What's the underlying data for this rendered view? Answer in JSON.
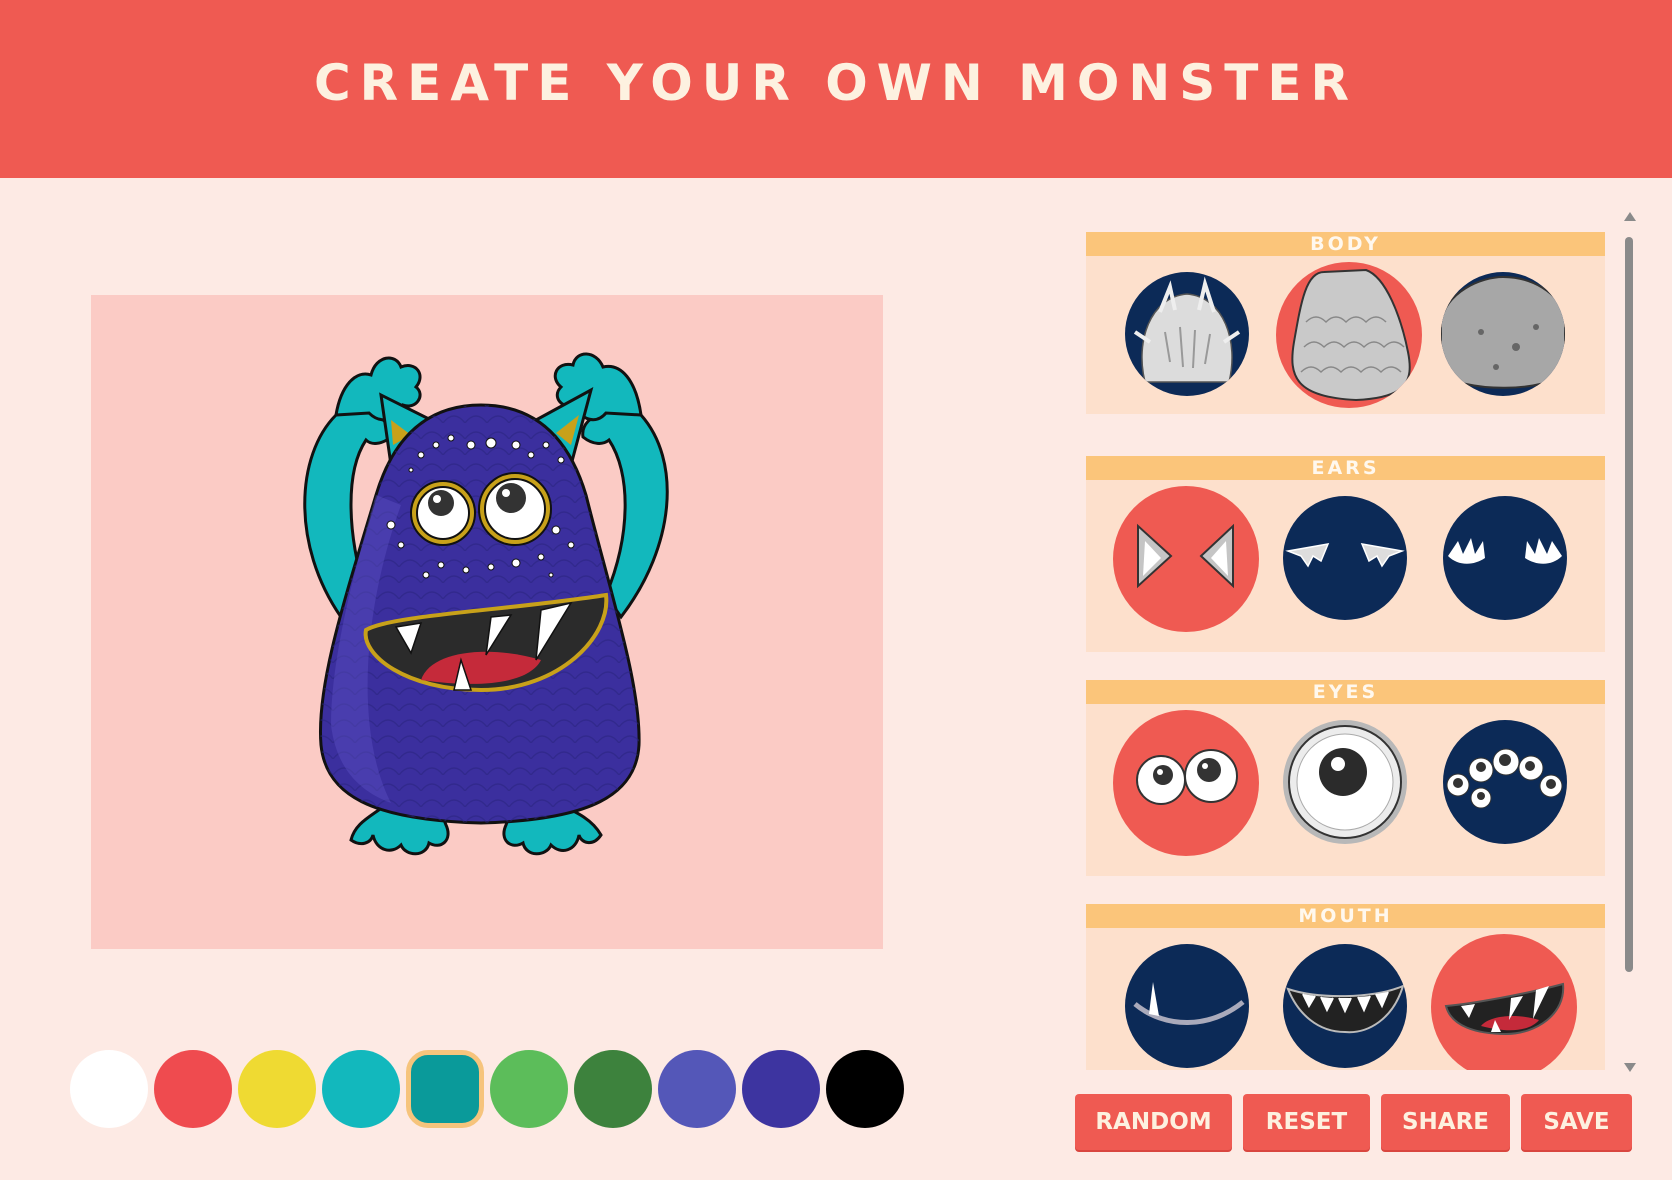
{
  "header": {
    "title": "CREATE YOUR OWN MONSTER"
  },
  "colors": {
    "accent": "#ef5a52",
    "background": "#fdeae4",
    "section_title_bg": "#fbc57a",
    "option_bg": "#0c2a57"
  },
  "swatches": [
    {
      "name": "white",
      "color": "#ffffff"
    },
    {
      "name": "red",
      "color": "#ef4b4f"
    },
    {
      "name": "yellow",
      "color": "#efda32"
    },
    {
      "name": "cyan",
      "color": "#12b8bd"
    },
    {
      "name": "teal",
      "color": "#0a9a9a",
      "selected": true
    },
    {
      "name": "light-green",
      "color": "#5cbd5a"
    },
    {
      "name": "dark-green",
      "color": "#3d823d"
    },
    {
      "name": "slate-blue",
      "color": "#5457b8"
    },
    {
      "name": "indigo",
      "color": "#3d34a0"
    },
    {
      "name": "black",
      "color": "#000000"
    }
  ],
  "panel": {
    "sections": [
      {
        "title": "BODY",
        "selected_index": 1
      },
      {
        "title": "EARS",
        "selected_index": 0
      },
      {
        "title": "EYES",
        "selected_index": 0
      },
      {
        "title": "MOUTH",
        "selected_index": 2
      }
    ]
  },
  "actions": {
    "random": "RANDOM",
    "reset": "RESET",
    "share": "SHARE",
    "save": "SAVE"
  }
}
